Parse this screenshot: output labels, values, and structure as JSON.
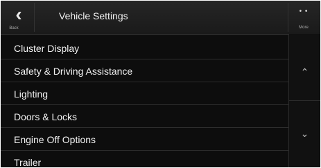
{
  "header": {
    "back_icon": "chevron-left-icon",
    "back_label": "Back",
    "title": "Vehicle Settings",
    "more_icon": "more-dots-icon",
    "more_label": "More"
  },
  "menu": {
    "items": [
      {
        "label": "Cluster Display"
      },
      {
        "label": "Safety & Driving Assistance"
      },
      {
        "label": "Lighting"
      },
      {
        "label": "Doors & Locks"
      },
      {
        "label": "Engine Off Options"
      },
      {
        "label": "Trailer"
      }
    ]
  },
  "scrollbar": {
    "up_icon": "page-up-icon",
    "down_icon": "page-down-icon"
  },
  "colors": {
    "background": "#0d0d0d",
    "header": "#222222",
    "text": "#f2f2f2"
  }
}
